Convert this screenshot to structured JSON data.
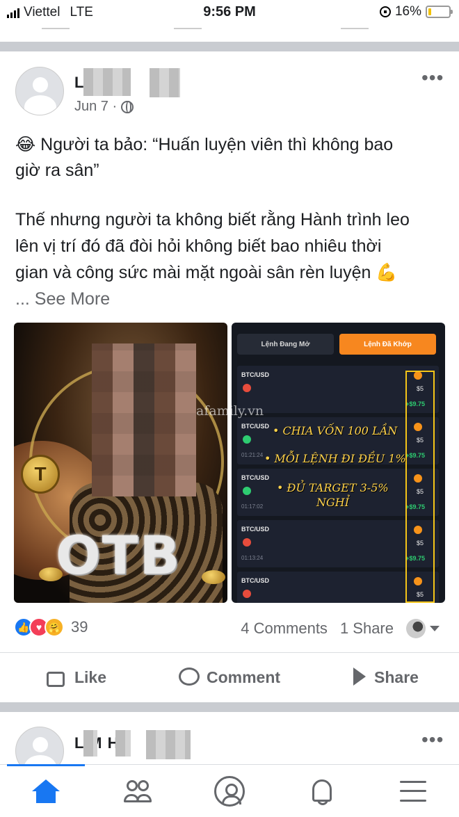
{
  "status_bar": {
    "carrier": "Viettel",
    "network": "LTE",
    "time": "9:56 PM",
    "battery_percent": "16%",
    "battery_level": 0.16,
    "colors": {
      "battery_fill": "#f2c200"
    }
  },
  "post": {
    "author_name_visible": "L H",
    "date": "Jun 7 ·",
    "privacy_icon": "globe-icon",
    "more_icon": "more-horizontal-icon",
    "text_line_1": "😂 Người ta bảo: “Huấn luyện viên thì không bao",
    "text_line_2": "giờ ra sân”",
    "text_line_3": "Thế nhưng người ta không biết rằng Hành trình leo",
    "text_line_4": "lên vị trí đó đã đòi hỏi không biết bao nhiêu thời",
    "text_line_5": "gian và công sức mài mặt ngoài sân rèn luyện 💪",
    "see_more": "... See More",
    "images": {
      "left": {
        "brand_text": "OTB",
        "coin_letter": "T"
      },
      "right": {
        "tab_open": "Lệnh Đang Mở",
        "tab_done": "Lệnh Đã Khớp",
        "watermark": "afamily.vn",
        "trades": [
          {
            "pair": "BTC/USD",
            "direction": "down",
            "time": "",
            "amount": "$5",
            "profit": "+$9.75"
          },
          {
            "pair": "BTC/USD",
            "direction": "up",
            "time": "01:21:24",
            "amount": "$5",
            "profit": "+$9.75"
          },
          {
            "pair": "BTC/USD",
            "direction": "up",
            "time": "01:17:02",
            "amount": "$5",
            "profit": "+$9.75"
          },
          {
            "pair": "BTC/USD",
            "direction": "down",
            "time": "01:13:24",
            "amount": "$5",
            "profit": "+$9.75"
          },
          {
            "pair": "BTC/USD",
            "direction": "down",
            "time": "",
            "amount": "$5",
            "profit": ""
          }
        ],
        "overlay_1": "• CHIA VỐN 100 LẦN",
        "overlay_2": "• MỖI LỆNH ĐI ĐỀU 1%",
        "overlay_3": "• ĐỦ TARGET 3-5%",
        "overlay_4": "NGHỈ",
        "colors": {
          "active_tab": "#f7871f",
          "profit": "#2ecc71",
          "up": "#2ecc71",
          "down": "#e74c3c",
          "highlight": "#f5c518"
        }
      }
    },
    "reaction_count": "39",
    "comments": "4 Comments",
    "shares": "1 Share",
    "actions": {
      "like": "Like",
      "comment": "Comment",
      "share": "Share"
    }
  },
  "next_post": {
    "author_name_visible": "L M H"
  },
  "bottom_nav": [
    {
      "icon": "home-icon",
      "active": true
    },
    {
      "icon": "friends-icon",
      "active": false
    },
    {
      "icon": "profile-icon",
      "active": false
    },
    {
      "icon": "notifications-icon",
      "active": false
    },
    {
      "icon": "menu-icon",
      "active": false
    }
  ],
  "colors": {
    "accent": "#1877f2",
    "divider": "#c9ccd1",
    "secondary_text": "#65676b"
  }
}
